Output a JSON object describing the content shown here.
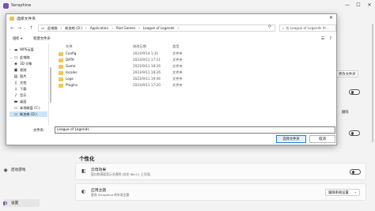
{
  "app": {
    "title": "Seraphine",
    "window_controls": [
      "—",
      "☐",
      "✕"
    ],
    "sidebar": {
      "bottom_items": [
        {
          "label": "启动游戏",
          "icon": "gamepad-icon"
        },
        {
          "label": "设置",
          "icon": "gear-icon",
          "active": true
        }
      ]
    },
    "personalization": {
      "section_title": "个性化",
      "cards": [
        {
          "title": "云母效果",
          "subtitle": "窗口和表面显示半透明 (仅在 Win11 上可用)",
          "icon": "mica-icon",
          "control": "toggle"
        },
        {
          "title": "应用主题",
          "subtitle": "更改 Seraphine 的外观主题",
          "icon": "palette-icon",
          "control": "combo",
          "value": "跟随系统设置"
        }
      ]
    },
    "right_fragments": {
      "button_1": "更改文件夹",
      "delete": "删除"
    }
  },
  "dialog": {
    "title": "选择文件夹",
    "address": {
      "segments": [
        "此电脑",
        "新加卷 (D:)",
        "Application",
        "Riot Games",
        "League of Legends"
      ],
      "search_placeholder": "在 League of Legends 中..."
    },
    "commands": {
      "organize": "组织 ▾",
      "new_folder": "新建文件夹"
    },
    "nav": [
      {
        "label": "WPS云盘",
        "icon": "cloud-icon"
      },
      {
        "label": "此电脑",
        "icon": "computer-icon"
      },
      {
        "label": "3D 对象",
        "icon": "cube-icon"
      },
      {
        "label": "视频",
        "icon": "video-icon"
      },
      {
        "label": "图片",
        "icon": "picture-icon"
      },
      {
        "label": "文档",
        "icon": "document-icon"
      },
      {
        "label": "下载",
        "icon": "download-icon"
      },
      {
        "label": "音乐",
        "icon": "music-icon"
      },
      {
        "label": "桌面",
        "icon": "desktop-icon"
      },
      {
        "label": "本地磁盘 (C:)",
        "icon": "drive-icon"
      },
      {
        "label": "新加卷 (D:)",
        "icon": "drive-icon",
        "selected": true
      }
    ],
    "columns": {
      "name": "名称",
      "date": "修改日期",
      "type": "类型"
    },
    "files": [
      {
        "name": "Config",
        "date": "2023/9/14 1:31",
        "type": "文件夹"
      },
      {
        "name": "DATA",
        "date": "2023/9/11 17:21",
        "type": "文件夹"
      },
      {
        "name": "Game",
        "date": "2023/9/11 18:26",
        "type": "文件夹"
      },
      {
        "name": "locales",
        "date": "2023/9/11 18:26",
        "type": "文件夹"
      },
      {
        "name": "Logs",
        "date": "2023/9/11 19:46",
        "type": "文件夹"
      },
      {
        "name": "Plugins",
        "date": "2023/9/11 17:20",
        "type": "文件夹"
      }
    ],
    "filename_label": "文件夹:",
    "filename_value": "League of Legends",
    "select_button": "选择文件夹",
    "cancel_button": "取消"
  }
}
